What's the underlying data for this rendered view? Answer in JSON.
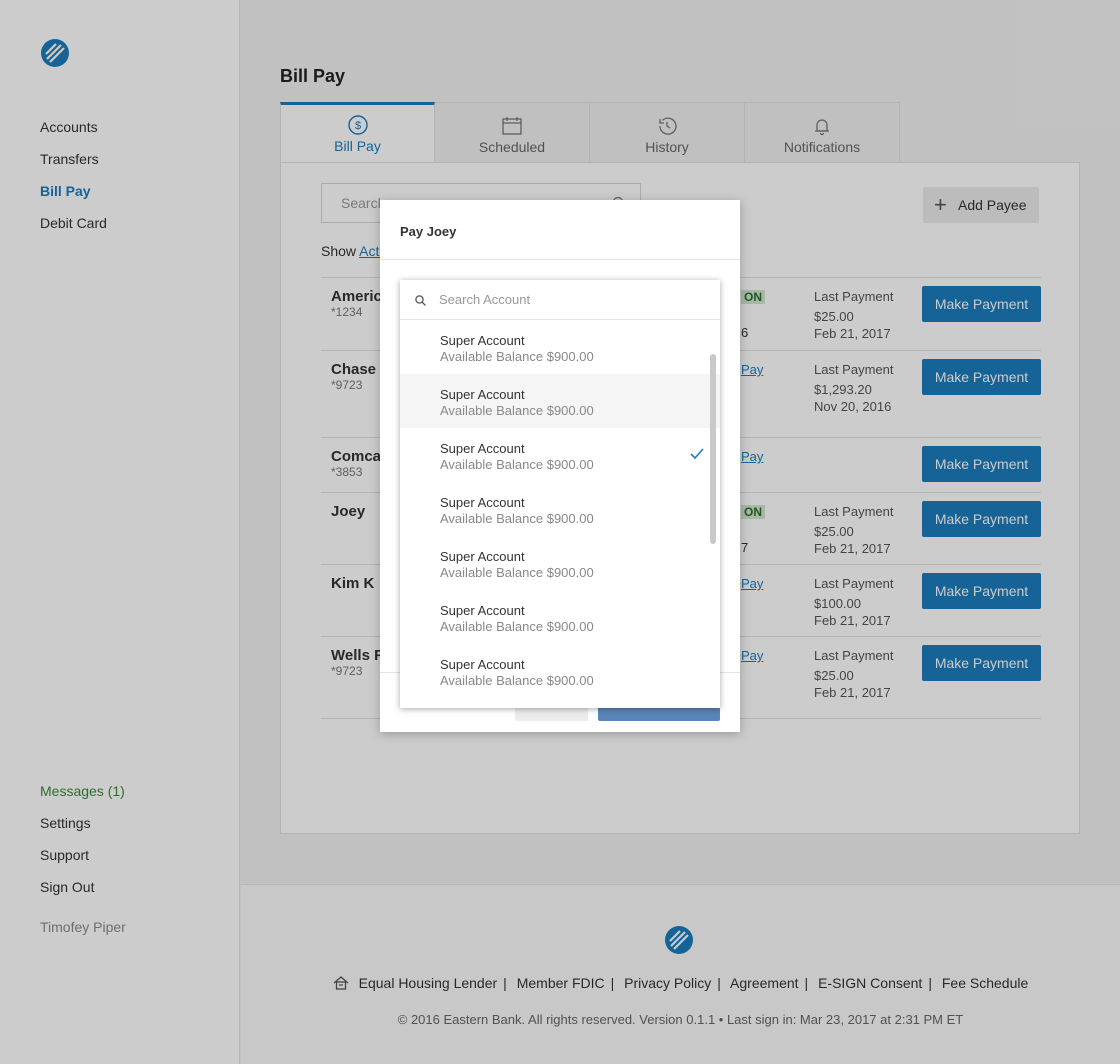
{
  "sidebar": {
    "nav_top": [
      "Accounts",
      "Transfers",
      "Bill Pay",
      "Debit Card"
    ],
    "nav_bottom": [
      "Messages (1)",
      "Settings",
      "Support",
      "Sign Out"
    ],
    "username": "Timofey Piper"
  },
  "page": {
    "title": "Bill Pay",
    "tabs": [
      "Bill Pay",
      "Scheduled",
      "History",
      "Notifications"
    ],
    "search_placeholder": "Search",
    "add_payee": "Add Payee",
    "show_label": "Show",
    "show_link": "Acti"
  },
  "payees": [
    {
      "name": "America",
      "acct": "*1234",
      "mid": "ON",
      "mid2": "6",
      "last_label": "Last Payment",
      "amount": "$25.00",
      "date": "Feb 21, 2017",
      "button": "Make Payment"
    },
    {
      "name": "Chase",
      "acct": "*9723",
      "mid": "Pay",
      "last_label": "Last Payment",
      "amount": "$1,293.20",
      "date": "Nov 20, 2016",
      "button": "Make Payment"
    },
    {
      "name": "Comcas",
      "acct": "*3853",
      "mid": "Pay",
      "button": "Make Payment"
    },
    {
      "name": "Joey",
      "acct": "",
      "mid": "ON",
      "mid2": "7",
      "last_label": "Last Payment",
      "amount": "$25.00",
      "date": "Feb 21, 2017",
      "button": "Make Payment"
    },
    {
      "name": "Kim K",
      "acct": "",
      "mid": "Pay",
      "last_label": "Last Payment",
      "amount": "$100.00",
      "date": "Feb 21, 2017",
      "button": "Make Payment"
    },
    {
      "name": "Wells Fa",
      "acct": "*9723",
      "mid": "Pay",
      "last_label": "Last Payment",
      "amount": "$25.00",
      "date": "Feb 21, 2017",
      "button": "Make Payment"
    }
  ],
  "modal": {
    "title": "Pay Joey",
    "search_placeholder": "Search Account",
    "accounts": [
      {
        "name": "Super Account",
        "balance": "Available Balance $900.00"
      },
      {
        "name": "Super Account",
        "balance": "Available Balance $900.00"
      },
      {
        "name": "Super Account",
        "balance": "Available Balance $900.00"
      },
      {
        "name": "Super Account",
        "balance": "Available Balance $900.00"
      },
      {
        "name": "Super Account",
        "balance": "Available Balance $900.00"
      },
      {
        "name": "Super Account",
        "balance": "Available Balance $900.00"
      },
      {
        "name": "Super Account",
        "balance": "Available Balance $900.00"
      }
    ]
  },
  "footer": {
    "links": [
      "Equal Housing Lender",
      "Member FDIC",
      "Privacy Policy",
      "Agreement",
      "E-SIGN Consent",
      "Fee Schedule"
    ],
    "copyright": "© 2016 Eastern Bank. All rights reserved. Version 0.1.1 • Last sign in: Mar 23, 2017 at 2:31 PM ET"
  },
  "colors": {
    "accent": "#1b7cbd",
    "messages": "#3a8a3a",
    "badge_bg": "#cfe8cf"
  },
  "icons": [
    "bank-logo-icon",
    "dollar-circle-icon",
    "calendar-icon",
    "history-icon",
    "bell-icon",
    "search-icon",
    "plus-icon",
    "check-icon",
    "house-icon"
  ]
}
